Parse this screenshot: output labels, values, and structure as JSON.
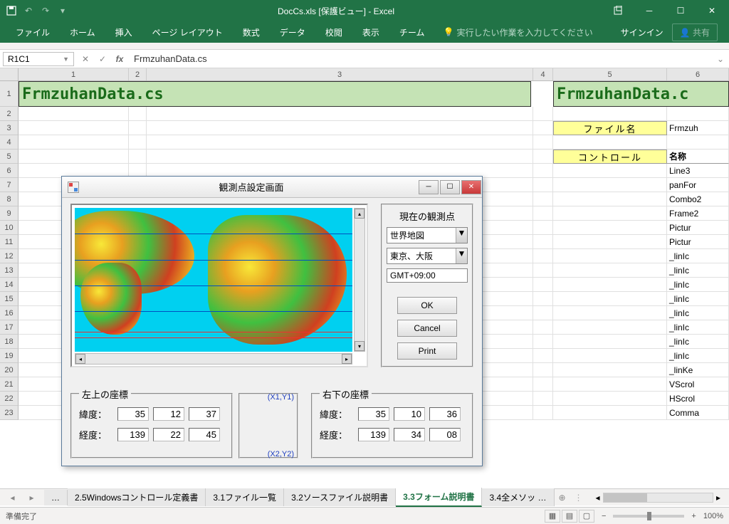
{
  "titlebar": {
    "title": "DocCs.xls  [保護ビュー] - Excel"
  },
  "ribbon": {
    "tabs": [
      "ファイル",
      "ホーム",
      "挿入",
      "ページ レイアウト",
      "数式",
      "データ",
      "校閲",
      "表示",
      "チーム"
    ],
    "tellme": "実行したい作業を入力してください",
    "signin": "サインイン",
    "share": "共有"
  },
  "formula": {
    "name_box": "R1C1",
    "value": "FrmzuhanData.cs"
  },
  "columns": [
    "1",
    "2",
    "3",
    "4",
    "5",
    "6"
  ],
  "row_numbers": [
    "1",
    "2",
    "3",
    "4",
    "5",
    "6",
    "7",
    "8",
    "9",
    "10",
    "11",
    "12",
    "13",
    "14",
    "15",
    "16",
    "17",
    "18",
    "19",
    "20",
    "21",
    "22",
    "23"
  ],
  "big_cells": {
    "a": "FrmzuhanData.cs",
    "b": "FrmzuhanData.c"
  },
  "col5": {
    "header1": "ファイル名",
    "header2": "コントロール"
  },
  "col6": {
    "r3": "Frmzuh",
    "r5": "名称",
    "rows": [
      "Line3",
      "panFor",
      "Combo2",
      "Frame2",
      "Pictur",
      "Pictur",
      "_linIc",
      "_linIc",
      "_linIc",
      "_linIc",
      "_linIc",
      "_linIc",
      "_linIc",
      "_linIc",
      "_linKe",
      "VScrol",
      "HScrol",
      "Comma"
    ]
  },
  "dialog": {
    "title": "観測点設定画面",
    "obs_label": "現在の観測点",
    "combo1": "世界地図",
    "combo2": "東京、大阪",
    "gmt": "GMT+09:00",
    "btn_ok": "OK",
    "btn_cancel": "Cancel",
    "btn_print": "Print",
    "left_frame": "左上の座標",
    "right_frame": "右下の座標",
    "lat": "緯度：",
    "lon": "経度：",
    "left_vals": {
      "lat": [
        "35",
        "12",
        "37"
      ],
      "lon": [
        "139",
        "22",
        "45"
      ]
    },
    "right_vals": {
      "lat": [
        "35",
        "10",
        "36"
      ],
      "lon": [
        "139",
        "34",
        "08"
      ]
    },
    "xy1": "(X1,Y1)",
    "xy2": "(X2,Y2)"
  },
  "sheets": {
    "nav_more": "…",
    "tabs": [
      "2.5Windowsコントロール定義書",
      "3.1ファイル一覧",
      "3.2ソースファイル説明書",
      "3.3フォーム説明書",
      "3.4全メソッ"
    ],
    "active_index": 3
  },
  "status": {
    "left": "準備完了",
    "zoom": "100%"
  }
}
